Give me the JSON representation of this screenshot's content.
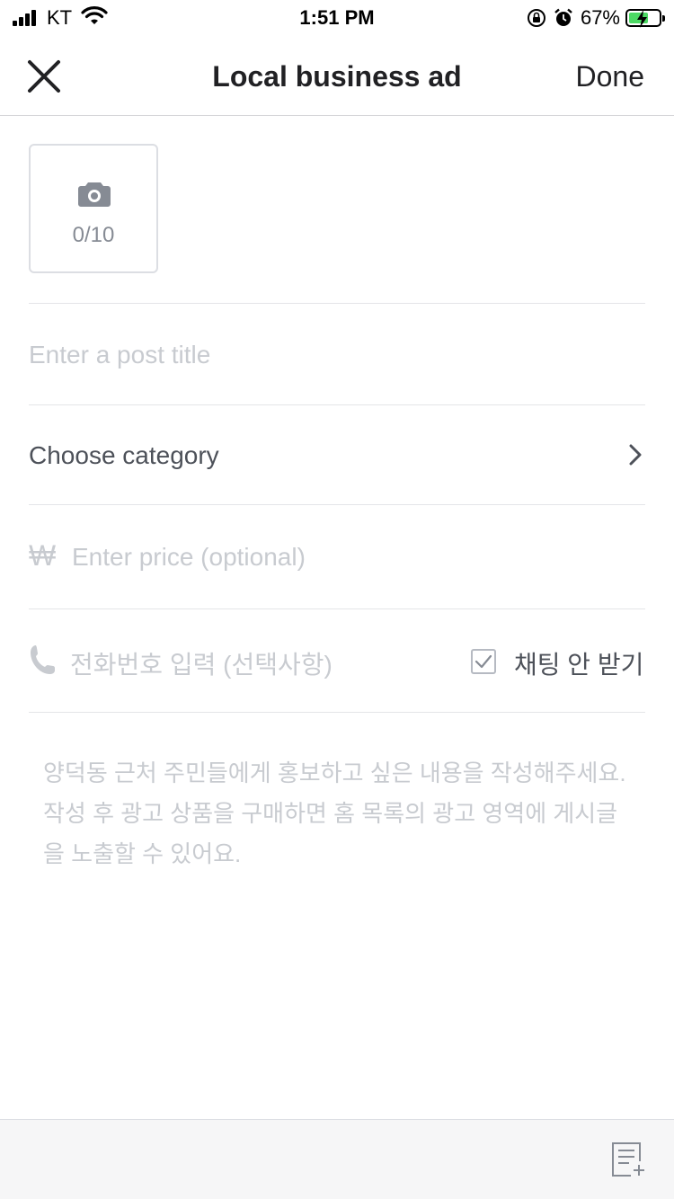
{
  "status_bar": {
    "carrier": "KT",
    "time": "1:51 PM",
    "battery_percent": "67%",
    "battery_level": 0.67,
    "icons": [
      "signal-icon",
      "wifi-icon",
      "orientation-lock-icon",
      "alarm-icon",
      "battery-charging-icon"
    ]
  },
  "nav": {
    "close_icon": "close-icon",
    "title": "Local business ad",
    "done_label": "Done"
  },
  "photo": {
    "icon": "camera-icon",
    "count": "0/10"
  },
  "form": {
    "title_placeholder": "Enter a post title",
    "category_label": "Choose category",
    "price_currency": "₩",
    "price_placeholder": "Enter price (optional)",
    "phone_placeholder": "전화번호 입력 (선택사항)",
    "no_chat_label": "채팅 안 받기",
    "description_placeholder": "양덕동 근처 주민들에게 홍보하고 싶은 내용을 작성해주세요. 작성 후 광고 상품을 구매하면 홈 목록의 광고 영역에 게시글을 노출할 수 있어요."
  },
  "colors": {
    "text": "#212124",
    "placeholder": "#c8cbd0",
    "divider": "#e4e5e8",
    "toolbar_bg": "#f6f6f7"
  }
}
